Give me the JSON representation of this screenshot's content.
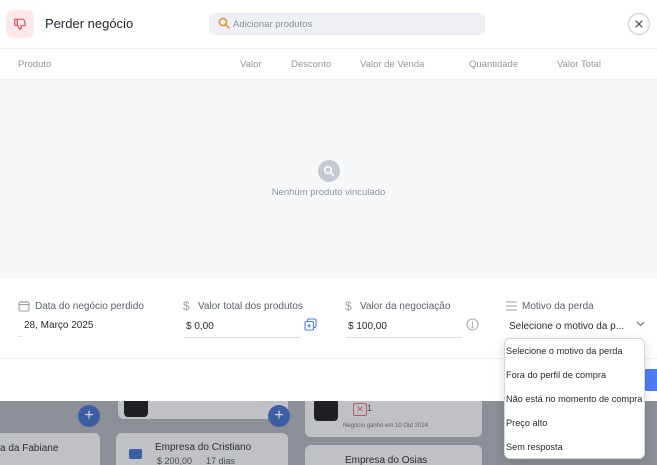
{
  "modal": {
    "title": "Perder negócio",
    "search_placeholder": "Adicionar produtos",
    "columns": [
      "Produto",
      "Valor",
      "Desconto",
      "Valor de Venda",
      "Quantidade",
      "Valor Total"
    ],
    "empty_text": "Nenhum produto vinculado",
    "fields": {
      "lost_date": {
        "label": "Data do negócio perdido",
        "value": "28, Março 2025"
      },
      "products_total": {
        "label": "Valor total dos produtos",
        "value": "$ 0,00"
      },
      "negotiation_value": {
        "label": "Valor da negociação",
        "value": "$ 100,00"
      },
      "loss_reason": {
        "label": "Motivo da perda",
        "value": "Selecione o motivo da p..."
      }
    },
    "dropdown_options": [
      "Selecione o motivo da perda",
      "Fora do perfil de compra",
      "Não está no momento de compra",
      "Preço alto",
      "Sem resposta"
    ]
  },
  "background": {
    "cards": [
      {
        "name": "a da Fabiane"
      },
      {
        "name": "Empresa do Cristiano",
        "value": "$ 200,00",
        "days": "17 dias"
      },
      {
        "name": "Empresa do Osias"
      }
    ],
    "lost_note": "Negócio ganho em 10 Out 2024",
    "badge_count": "1"
  },
  "colors": {
    "accent": "#4f7cf3",
    "danger": "#e25563",
    "search_icon": "#e0922e"
  }
}
